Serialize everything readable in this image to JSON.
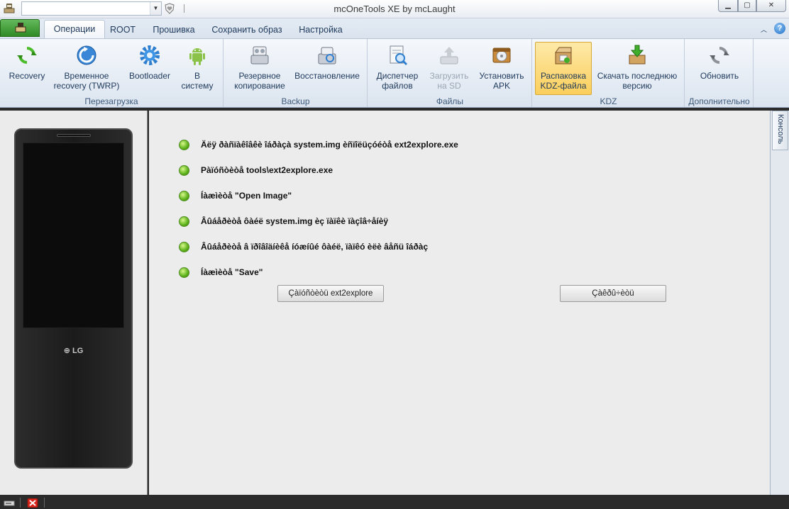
{
  "window": {
    "title": "mcOneTools XE by mcLaught",
    "minimize_glyph": "▁",
    "maximize_glyph": "▢",
    "close_glyph": "✕"
  },
  "quick_access": {
    "combo_value": "",
    "arrow_glyph": "▼"
  },
  "tabs": [
    {
      "label": "Операции",
      "active": true
    },
    {
      "label": "ROOT",
      "active": false
    },
    {
      "label": "Прошивка",
      "active": false
    },
    {
      "label": "Сохранить образ",
      "active": false
    },
    {
      "label": "Настройка",
      "active": false
    }
  ],
  "help_glyph": "?",
  "ribbon_minimize_glyph": "︿",
  "ribbon": {
    "groups": [
      {
        "label": "Перезагрузка",
        "buttons": [
          {
            "label": "Recovery",
            "icon": "refresh-icon"
          },
          {
            "label": "Временное recovery (TWRP)",
            "icon": "temporary-recovery-icon"
          },
          {
            "label": "Bootloader",
            "icon": "gear-icon"
          },
          {
            "label": "В систему",
            "icon": "android-icon"
          }
        ]
      },
      {
        "label": "Backup",
        "buttons": [
          {
            "label": "Резервное копирование",
            "icon": "backup-icon"
          },
          {
            "label": "Восстановление",
            "icon": "restore-icon"
          }
        ]
      },
      {
        "label": "Файлы",
        "buttons": [
          {
            "label": "Диспетчер файлов",
            "icon": "file-manager-icon"
          },
          {
            "label": "Загрузить на SD",
            "icon": "upload-sd-icon",
            "disabled": true
          },
          {
            "label": "Установить APK",
            "icon": "install-apk-icon"
          }
        ]
      },
      {
        "label": "KDZ",
        "buttons": [
          {
            "label": "Распаковка KDZ-файла",
            "icon": "unpack-kdz-icon",
            "selected": true
          },
          {
            "label": "Скачать последнюю версию",
            "icon": "download-icon"
          }
        ]
      },
      {
        "label": "Дополнительно",
        "buttons": [
          {
            "label": "Обновить",
            "icon": "update-icon"
          }
        ]
      }
    ]
  },
  "phone": {
    "logo_text": "⊕ LG"
  },
  "steps": [
    "Äëÿ ðàñïàêîâêè îáðàçà system.img èñïîëüçóéòå ext2explore.exe",
    "Pàïóñòèòå tools\\ext2explore.exe",
    "Íàæìèòå \"Open Image\"",
    "Âûáåðèòå ôàéë system.img èç ïàïêè ïàçîâ÷åíèÿ",
    "Âûáåðèòå â ïðîâîäíèêå íóæíûé ôàéë, ïàïêó èëè âåñü îáðàç",
    "Íàæìèòå \"Save\""
  ],
  "buttons": {
    "launch": "Çàïóñòèòü ext2explore",
    "close": "Çàêðû÷èòü"
  },
  "console_label": "Консоль",
  "colors": {
    "accent_green": "#3f8412",
    "selected_highlight": "#fbcf5c",
    "ribbon_text": "#1e395b"
  }
}
